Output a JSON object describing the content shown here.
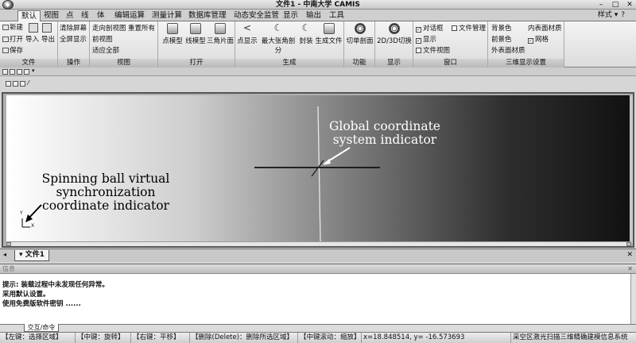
{
  "window": {
    "title": "文件1 - 中南大学 CAMIS",
    "minimize": "–",
    "maximize": "□",
    "close": "✕"
  },
  "tabs": [
    "默认",
    "视图",
    "点",
    "线",
    "体",
    "编辑运算",
    "测量计算",
    "数据库管理",
    "动态安全监管",
    "显示",
    "输出",
    "工具"
  ],
  "style_menu": "样式",
  "ribbon": {
    "file": {
      "label": "文件",
      "new": "新建",
      "open": "打开",
      "import": "导入",
      "export": "导出",
      "save": "保存"
    },
    "operate": {
      "label": "操作",
      "clear": "清除屏幕",
      "fullscreen": "全屏显示"
    },
    "view": {
      "label": "视图",
      "walk": "走向剖视图",
      "reset": "重置所有",
      "front": "前视图",
      "fitall": "适应全部"
    },
    "open_grp": {
      "label": "打开",
      "point": "点模型",
      "line": "线模型",
      "triangle": "三角片面"
    },
    "generate": {
      "label": "生成",
      "pointshow": "点显示",
      "maxangle": "最大张角剖分",
      "seal": "封装",
      "genfile": "生成文件"
    },
    "func": {
      "label": "功能",
      "cut": "切单剖面"
    },
    "display": {
      "label": "显示",
      "switch": "2D/3D切换"
    },
    "window": {
      "label": "窗口",
      "dialog": "对话框",
      "filemgr": "文件管理",
      "show": "显示",
      "fileview": "文件视图"
    },
    "d3": {
      "label": "三维显示设置",
      "bg": "背景色",
      "inner": "内表面材质",
      "fg": "前景色",
      "grid": "网格",
      "outer": "外表面材质"
    }
  },
  "viewport": {
    "annotation_global": "Global coordinate\nsystem indicator",
    "annotation_ball": "Spinning ball virtual\nsynchronization\ncoordinate indicator",
    "axis_y": "Y",
    "axis_x": "X"
  },
  "doc_tab": "文件1",
  "info": {
    "header": "信息",
    "close": "✕",
    "lines": [
      "提示: 装载过程中未发现任何异常。",
      "采用默认设置。",
      "使用免费版软件密钥 ......"
    ]
  },
  "cmd_tab": "交互/命令",
  "status": {
    "left": "【左键：选择区域】",
    "middle": "【中键：旋转】",
    "right": "【右键：平移】",
    "delete": "【删除(Delete)：删除所选区域】",
    "wheel": "【中键滚动：缩放】",
    "coords": "x=18.848514, y= -16.573693",
    "system": "采空区激光扫描三维精确建模信息系统"
  },
  "colors": {
    "viewport_left": "#ffffff",
    "viewport_right": "#111111"
  }
}
